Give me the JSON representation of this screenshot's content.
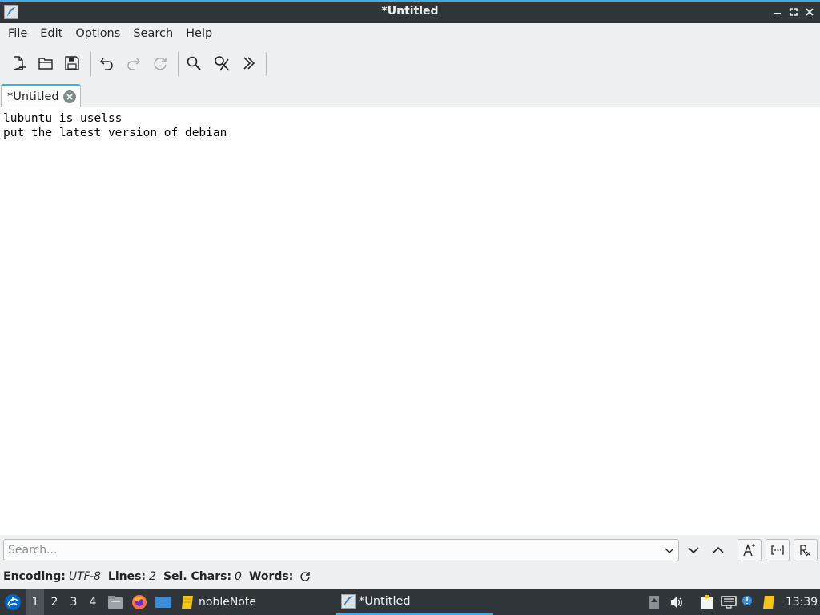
{
  "window": {
    "title": "*Untitled"
  },
  "menu": [
    "File",
    "Edit",
    "Options",
    "Search",
    "Help"
  ],
  "toolbar": {
    "buttons": [
      {
        "icon": "new-document-icon"
      },
      {
        "icon": "open-folder-icon"
      },
      {
        "icon": "save-icon"
      },
      {
        "icon": "undo-icon"
      },
      {
        "icon": "redo-icon"
      },
      {
        "icon": "reload-icon"
      },
      {
        "icon": "find-icon"
      },
      {
        "icon": "find-replace-icon"
      },
      {
        "icon": "more-chevrons-icon"
      }
    ]
  },
  "tabs": [
    {
      "label": "*Untitled"
    }
  ],
  "editor": {
    "lines": [
      "lubuntu is uselss",
      "put the latest version of debian"
    ]
  },
  "search": {
    "placeholder": "Search..."
  },
  "status": {
    "encoding_label": "Encoding:",
    "encoding_value": "UTF-8",
    "lines_label": "Lines:",
    "lines_value": "2",
    "selchars_label": "Sel. Chars:",
    "selchars_value": "0",
    "words_label": "Words:"
  },
  "taskbar": {
    "desktops": [
      "1",
      "2",
      "3",
      "4"
    ],
    "active_desktop": "1",
    "pinned_note_label": "nobleNote",
    "window_label": "*Untitled",
    "clock": "13:39"
  },
  "colors": {
    "accent": "#3daee9",
    "titlebar": "#31363b",
    "taskbar": "#31363b"
  }
}
